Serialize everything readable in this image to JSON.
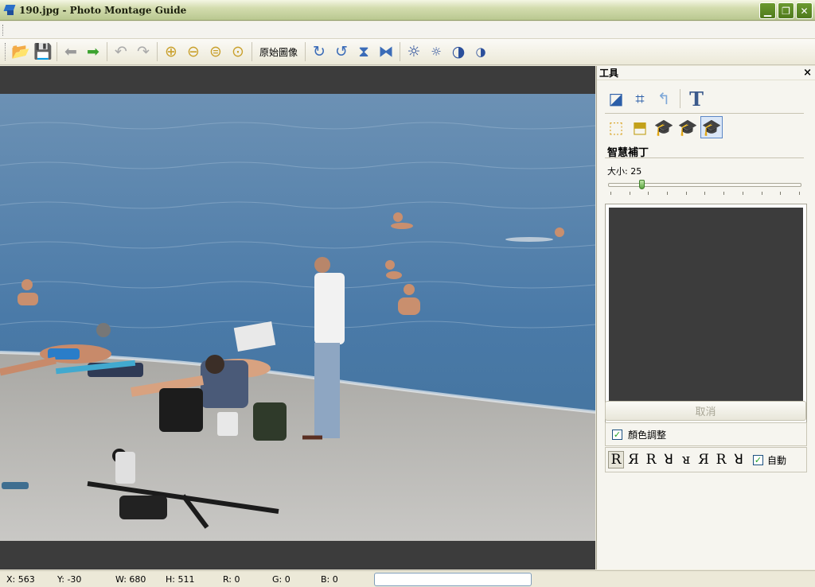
{
  "window": {
    "title": "190.jpg - Photo Montage Guide",
    "minimize_icon": "minimize-icon",
    "maximize_icon": "restore-icon",
    "close_icon": "close-icon"
  },
  "toolbar": {
    "original_label": "原始圖像",
    "icons": [
      "open-folder-icon",
      "save-icon",
      "back-arrow-icon",
      "forward-arrow-icon",
      "undo-icon",
      "redo-icon",
      "zoom-in-icon",
      "zoom-out-icon",
      "zoom-fit-icon",
      "zoom-actual-icon",
      "rotate-right-icon",
      "rotate-left-icon",
      "flip-vertical-icon",
      "flip-horizontal-icon",
      "brightness-up-icon",
      "brightness-down-icon",
      "contrast-up-icon",
      "contrast-down-icon"
    ]
  },
  "panel": {
    "title": "工具",
    "close_glyph": "×",
    "section_title": "智慧補丁",
    "size_label": "大小: 25",
    "size_value": 25,
    "cancel_label": "取消",
    "color_adjust_label": "顏色調整",
    "color_adjust_checked": true,
    "auto_label": "自動",
    "auto_checked": true,
    "r_glyphs": [
      "R",
      "Я",
      "R",
      "ꓤ",
      "ᴚ",
      "Я",
      "R",
      "ꓤ"
    ]
  },
  "statusbar": {
    "x": "X: 563",
    "y": "Y: -30",
    "w": "W: 680",
    "h": "H: 511",
    "r": "R: 0",
    "g": "G: 0",
    "b": "B: 0"
  },
  "colors": {
    "titlebar": "#c7d29f",
    "canvas_bg": "#3c3c3c",
    "sea": "#4c7aa6",
    "beach": "#b9b8b6"
  }
}
